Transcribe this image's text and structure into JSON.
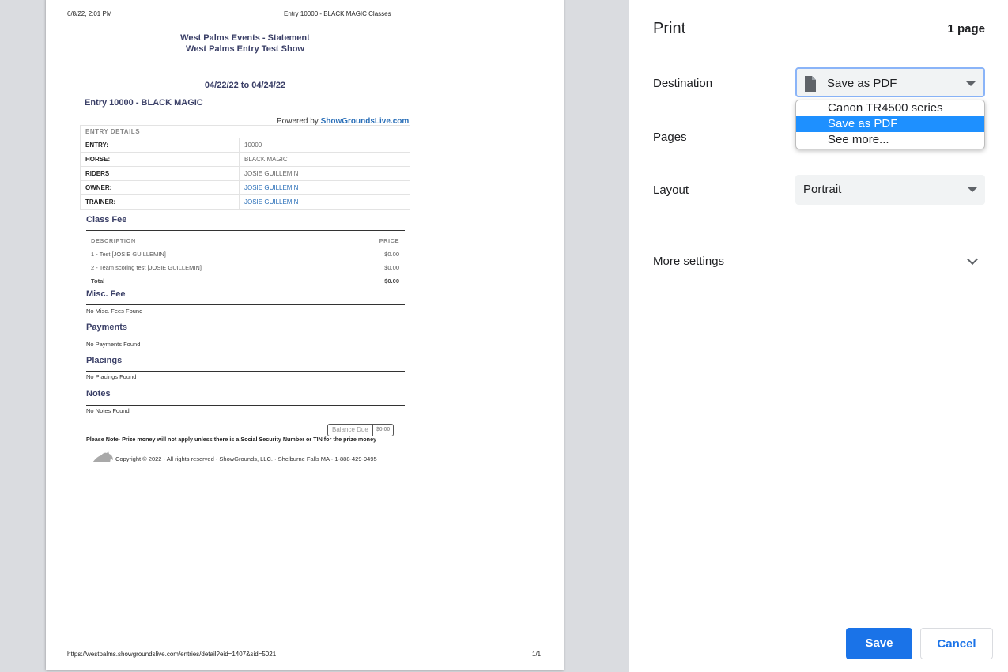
{
  "preview": {
    "header_date": "6/8/22, 2:01 PM",
    "header_title": "Entry 10000 - BLACK MAGIC Classes",
    "footer_url": "https://westpalms.showgroundslive.com/entries/detail?eid=1407&sid=5021",
    "footer_page": "1/1",
    "statement_title": "West Palms Events - Statement",
    "show_title": "West Palms Entry Test Show",
    "date_range": "04/22/22 to 04/24/22",
    "entry_title": "Entry 10000 - BLACK MAGIC",
    "powered_by": "Powered by",
    "brand": "ShowGroundsLive.com",
    "details": {
      "caption": "ENTRY DETAILS",
      "rows": [
        {
          "label": "ENTRY:",
          "value": "10000"
        },
        {
          "label": "HORSE:",
          "value": "BLACK MAGIC"
        },
        {
          "label": "RIDERS",
          "value": "JOSIE GUILLEMIN"
        },
        {
          "label": "OWNER:",
          "value": "JOSIE GUILLEMIN"
        },
        {
          "label": "TRAINER:",
          "value": "JOSIE GUILLEMIN"
        }
      ]
    },
    "class_fee": {
      "title": "Class Fee",
      "col_description": "DESCRIPTION",
      "col_price": "PRICE",
      "rows": [
        {
          "description": "1 - Test [JOSIE GUILLEMIN]",
          "price": "$0.00"
        },
        {
          "description": "2 - Team scoring test [JOSIE GUILLEMIN]",
          "price": "$0.00"
        }
      ],
      "total_label": "Total",
      "total_value": "$0.00"
    },
    "misc_fee": {
      "title": "Misc. Fee",
      "empty": "No Misc. Fees Found"
    },
    "payments": {
      "title": "Payments",
      "empty": "No Payments Found"
    },
    "placings": {
      "title": "Placings",
      "empty": "No Placings Found"
    },
    "notes": {
      "title": "Notes",
      "empty": "No Notes Found"
    },
    "balance_label": "Balance Due",
    "balance_value": "$0.00",
    "prize_note": "Please Note- Prize money will not apply unless there is a Social Security Number or TIN for the prize money",
    "copyright": "Copyright © 2022 · All rights reserved · ShowGrounds, LLC. · Shelburne Falls MA · 1-888-429-9495"
  },
  "panel": {
    "title": "Print",
    "page_count": "1 page",
    "destination_label": "Destination",
    "destination_value": "Save as PDF",
    "destination_options": [
      "Canon TR4500 series",
      "Save as PDF",
      "See more..."
    ],
    "pages_label": "Pages",
    "layout_label": "Layout",
    "layout_value": "Portrait",
    "more_settings_label": "More settings",
    "save_label": "Save",
    "cancel_label": "Cancel",
    "accent_color": "#1a73e8",
    "selected_color": "#1e90ff"
  }
}
